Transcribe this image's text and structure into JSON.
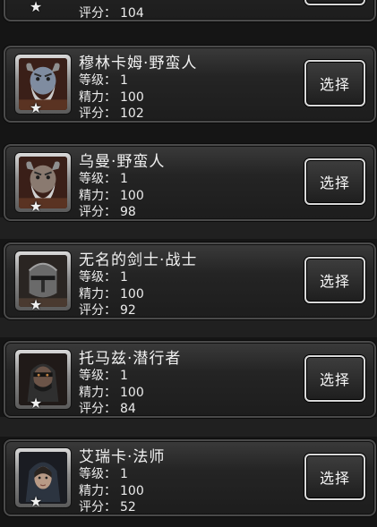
{
  "heroes": [
    {
      "name": "",
      "level_label": "",
      "level": "",
      "energy_label": "",
      "energy": "",
      "score_label": "评分",
      "score": "104",
      "select_label": "",
      "portrait_icon": "hero-portrait-icon"
    },
    {
      "name": "穆林卡姆·野蛮人",
      "level_label": "等级",
      "level": "1",
      "energy_label": "精力",
      "energy": "100",
      "score_label": "评分",
      "score": "102",
      "select_label": "选择",
      "portrait_icon": "barbarian-portrait-icon"
    },
    {
      "name": "乌曼·野蛮人",
      "level_label": "等级",
      "level": "1",
      "energy_label": "精力",
      "energy": "100",
      "score_label": "评分",
      "score": "98",
      "select_label": "选择",
      "portrait_icon": "barbarian-portrait-icon"
    },
    {
      "name": "无名的剑士·战士",
      "level_label": "等级",
      "level": "1",
      "energy_label": "精力",
      "energy": "100",
      "score_label": "评分",
      "score": "92",
      "select_label": "选择",
      "portrait_icon": "knight-helmet-portrait-icon"
    },
    {
      "name": "托马兹·潜行者",
      "level_label": "等级",
      "level": "1",
      "energy_label": "精力",
      "energy": "100",
      "score_label": "评分",
      "score": "84",
      "select_label": "选择",
      "portrait_icon": "rogue-portrait-icon"
    },
    {
      "name": "艾瑞卡·法师",
      "level_label": "等级",
      "level": "1",
      "energy_label": "精力",
      "energy": "100",
      "score_label": "评分",
      "score": "52",
      "select_label": "选择",
      "portrait_icon": "mage-portrait-icon"
    }
  ],
  "star_glyph": "★",
  "separator": "：",
  "colors": {
    "card_border": "#4a4a4a",
    "button_border": "#d8d8d8",
    "text": "#ebebeb"
  }
}
